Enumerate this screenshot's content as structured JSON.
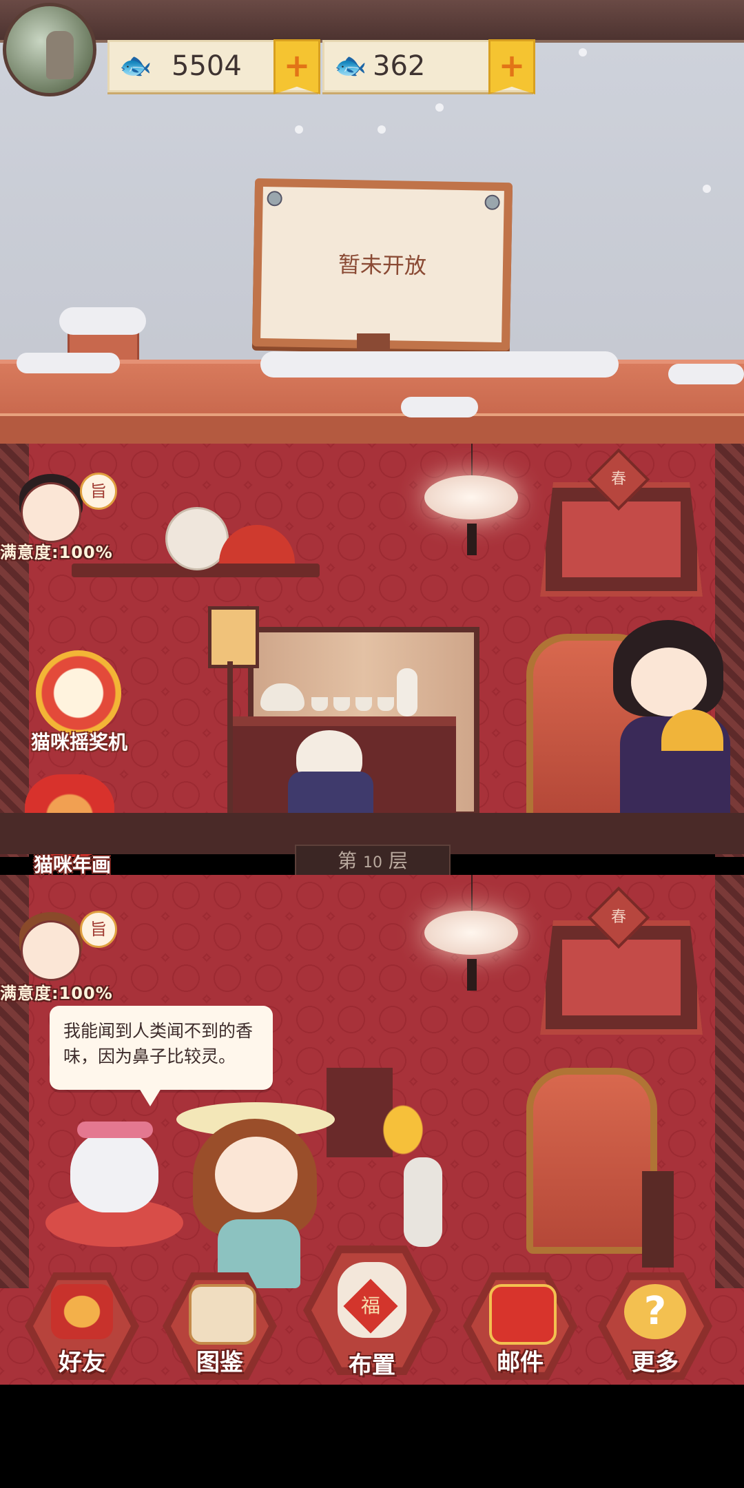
{
  "currencies": [
    {
      "icon": "silver-fish-icon",
      "value": "5504",
      "plus": "+"
    },
    {
      "icon": "gold-fish-icon",
      "value": "362",
      "plus": "+"
    }
  ],
  "sign": {
    "text": "暂未开放"
  },
  "floor_label": {
    "prefix": "第",
    "number": "10",
    "suffix": "层"
  },
  "upper_room": {
    "guest_badge": "旨",
    "satisfaction": "满意度:100%",
    "panel_char": "春"
  },
  "lower_room": {
    "guest_badge": "旨",
    "satisfaction": "满意度:100%",
    "panel_char": "春",
    "speech": "我能闻到人类闻不到的香味，因为鼻子比较灵。"
  },
  "side_features": [
    {
      "label": "猫咪摇奖机"
    },
    {
      "label": "猫咪年画"
    }
  ],
  "nav": [
    {
      "label": "好友",
      "icon": "friends-icon"
    },
    {
      "label": "图鉴",
      "icon": "album-icon"
    },
    {
      "label": "布置",
      "icon": "decorate-icon",
      "badge": "福"
    },
    {
      "label": "邮件",
      "icon": "mail-icon"
    },
    {
      "label": "更多",
      "icon": "more-icon",
      "glyph": "?"
    }
  ],
  "colors": {
    "wall": "#a8323a",
    "roof": "#c05e45",
    "accent_gold": "#f5c431"
  }
}
